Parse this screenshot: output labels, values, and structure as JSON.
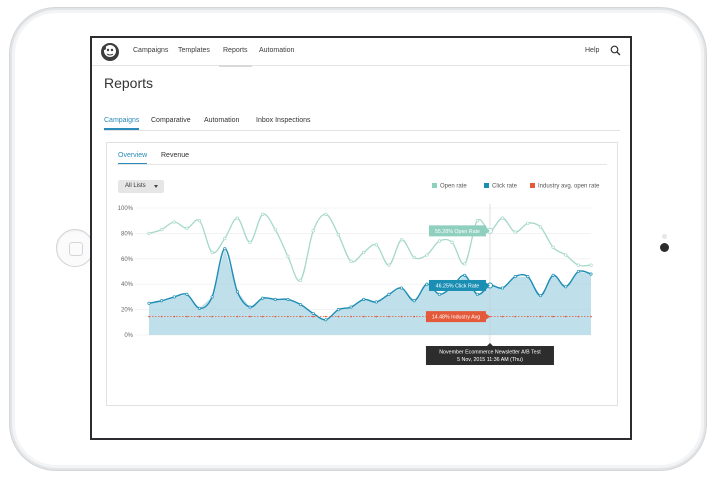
{
  "nav": {
    "items": [
      {
        "label": "Campaigns",
        "active": false
      },
      {
        "label": "Templates",
        "active": false
      },
      {
        "label": "Reports",
        "active": true
      },
      {
        "label": "Automation",
        "active": false
      }
    ],
    "help_label": "Help",
    "logo_icon": "mailchimp-logo-icon",
    "search_icon": "search-icon"
  },
  "page": {
    "title": "Reports"
  },
  "tabs": [
    {
      "label": "Campaigns",
      "active": true
    },
    {
      "label": "Comparative",
      "active": false
    },
    {
      "label": "Automation",
      "active": false
    },
    {
      "label": "Inbox Inspections",
      "active": false
    }
  ],
  "subtabs": [
    {
      "label": "Overview",
      "active": true
    },
    {
      "label": "Revenue",
      "active": false
    }
  ],
  "list_filter": {
    "selected": "All Lists"
  },
  "legend": [
    {
      "label": "Open rate",
      "color": "#8fcfbe"
    },
    {
      "label": "Click rate",
      "color": "#1b8eb3"
    },
    {
      "label": "Industry avg. open rate",
      "color": "#e4593a"
    }
  ],
  "tooltip": {
    "open_rate": "55.28% Open Rate",
    "click_rate": "46.25% Click Rate",
    "industry_avg": "14.48% Industry Avg",
    "campaign_name": "November Ecommerce Newsletter A/B Test",
    "timestamp": "5 Nov, 2015 11:36 AM (Thu)"
  },
  "colors": {
    "accent": "#2a8ab8",
    "open_line": "#a6d8cb",
    "click_line": "#1e8db4",
    "click_fill": "#a9d4e3",
    "industry": "#e4593a"
  },
  "chart_data": {
    "type": "line",
    "ylim": [
      0,
      100
    ],
    "yticks": [
      "100%",
      "80%",
      "60%",
      "40%",
      "20%",
      "0%"
    ],
    "x": [
      1,
      2,
      3,
      4,
      5,
      6,
      7,
      8,
      9,
      10,
      11,
      12,
      13,
      14,
      15,
      16,
      17,
      18,
      19,
      20,
      21,
      22,
      23,
      24,
      25,
      26,
      27,
      28,
      29,
      30,
      31,
      32,
      33,
      34,
      35,
      36
    ],
    "series": [
      {
        "name": "Open rate",
        "values": [
          80,
          83,
          89,
          84,
          90,
          65,
          76,
          92,
          73,
          95,
          83,
          62,
          43,
          82,
          95,
          79,
          58,
          65,
          71,
          55,
          75,
          61,
          63,
          74,
          73,
          56,
          90,
          82,
          92,
          81,
          88,
          85,
          69,
          63,
          55,
          55
        ]
      },
      {
        "name": "Click rate",
        "values": [
          25,
          27,
          30,
          32,
          21,
          30,
          68,
          34,
          22,
          29,
          28,
          28,
          24,
          17,
          12,
          20,
          22,
          28,
          26,
          32,
          37,
          27,
          40,
          32,
          38,
          47,
          32,
          39,
          37,
          46,
          46,
          31,
          47,
          38,
          50,
          48
        ]
      },
      {
        "name": "Industry avg. open rate",
        "values": [
          14.48,
          14.48,
          14.48,
          14.48,
          14.48,
          14.48,
          14.48,
          14.48,
          14.48,
          14.48,
          14.48,
          14.48,
          14.48,
          14.48,
          14.48,
          14.48,
          14.48,
          14.48,
          14.48,
          14.48,
          14.48,
          14.48,
          14.48,
          14.48,
          14.48,
          14.48,
          14.48,
          14.48,
          14.48,
          14.48,
          14.48,
          14.48,
          14.48,
          14.48,
          14.48,
          14.48
        ]
      }
    ],
    "highlight_index": 27,
    "grid": true,
    "legend_position": "top-right"
  }
}
